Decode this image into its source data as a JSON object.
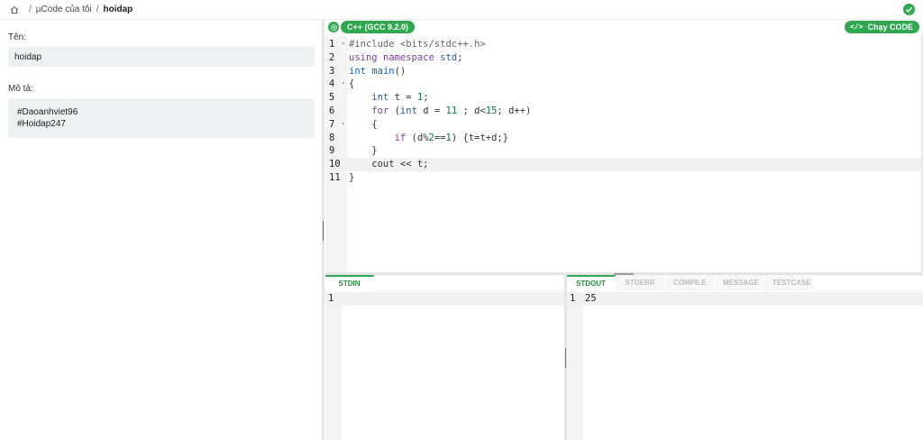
{
  "breadcrumb": {
    "sep1": "/",
    "parent": "µCode của tôi",
    "sep2": "/",
    "current": "hoidap"
  },
  "form": {
    "name_label": "Tên:",
    "name_value": "hoidap",
    "desc_label": "Mô tả:",
    "desc_line1": "#Daoanhviet96",
    "desc_line2": "#Hoidap247"
  },
  "editor": {
    "language": "C++ (GCC 9.2.0)",
    "run_label": "Chạy CODE",
    "run_icon": "</>",
    "active_line": 10,
    "lines": [
      {
        "n": "1",
        "fold": true
      },
      {
        "n": "2",
        "fold": false
      },
      {
        "n": "3",
        "fold": false
      },
      {
        "n": "4",
        "fold": true
      },
      {
        "n": "5",
        "fold": false
      },
      {
        "n": "6",
        "fold": false
      },
      {
        "n": "7",
        "fold": true
      },
      {
        "n": "8",
        "fold": false
      },
      {
        "n": "9",
        "fold": false
      },
      {
        "n": "10",
        "fold": false
      },
      {
        "n": "11",
        "fold": false
      }
    ],
    "code": [
      [
        {
          "t": "#include <bits/stdc++.h>",
          "c": "pp"
        }
      ],
      [
        {
          "t": "using",
          "c": "kw"
        },
        {
          "t": " "
        },
        {
          "t": "namespace",
          "c": "kw"
        },
        {
          "t": " "
        },
        {
          "t": "std",
          "c": "ty"
        },
        {
          "t": ";"
        }
      ],
      [
        {
          "t": "int",
          "c": "ty"
        },
        {
          "t": " "
        },
        {
          "t": "main",
          "c": "fn"
        },
        {
          "t": "()"
        }
      ],
      [
        {
          "t": "{"
        }
      ],
      [
        {
          "t": "    "
        },
        {
          "t": "int",
          "c": "ty"
        },
        {
          "t": " t = "
        },
        {
          "t": "1",
          "c": "num"
        },
        {
          "t": ";"
        }
      ],
      [
        {
          "t": "    "
        },
        {
          "t": "for",
          "c": "kw"
        },
        {
          "t": " ("
        },
        {
          "t": "int",
          "c": "ty"
        },
        {
          "t": " d = "
        },
        {
          "t": "11",
          "c": "num"
        },
        {
          "t": " ; d<"
        },
        {
          "t": "15",
          "c": "num"
        },
        {
          "t": "; d++)"
        }
      ],
      [
        {
          "t": "    {"
        }
      ],
      [
        {
          "t": "        "
        },
        {
          "t": "if",
          "c": "kw"
        },
        {
          "t": " (d%"
        },
        {
          "t": "2",
          "c": "num"
        },
        {
          "t": "=="
        },
        {
          "t": "1",
          "c": "num"
        },
        {
          "t": ") {t=t+d;}"
        }
      ],
      [
        {
          "t": "    }"
        }
      ],
      [
        {
          "t": "    cout << t;"
        }
      ],
      [
        {
          "t": "}"
        }
      ]
    ]
  },
  "stdin": {
    "tab_label": "STDIN",
    "line_number": "1",
    "value": ""
  },
  "output": {
    "tabs": [
      "STDOUT",
      "STDERR",
      "COMPILE",
      "MESSAGE",
      "TESTCASE"
    ],
    "active_tab": "STDOUT",
    "line_number": "1",
    "value": "25"
  },
  "colors": {
    "accent": "#2fa84f",
    "tab_active_text": "#2a8c46"
  },
  "icons": {
    "home": "home-icon",
    "status": "check-circle-icon",
    "settings": "gear-icon",
    "run": "code-icon"
  }
}
